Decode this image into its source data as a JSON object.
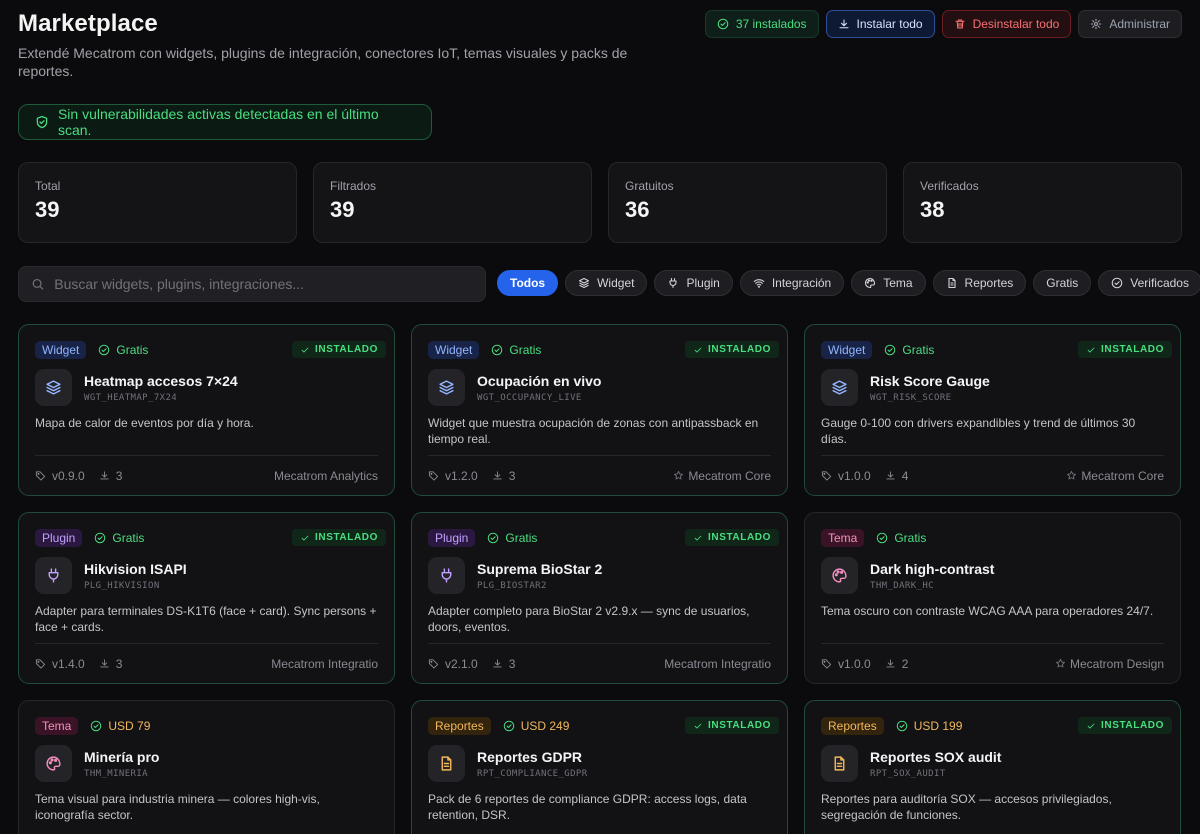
{
  "header": {
    "title": "Marketplace",
    "subtitle": "Extendé Mecatrom con widgets, plugins de integración, conectores IoT, temas visuales y packs de reportes.",
    "installed_label": "37 instalados",
    "install_all_label": "Instalar todo",
    "uninstall_all_label": "Desinstalar todo",
    "admin_label": "Administrar"
  },
  "alert": {
    "text": "Sin vulnerabilidades activas detectadas en el último scan."
  },
  "stats": [
    {
      "label": "Total",
      "value": "39"
    },
    {
      "label": "Filtrados",
      "value": "39"
    },
    {
      "label": "Gratuitos",
      "value": "36"
    },
    {
      "label": "Verificados",
      "value": "38"
    }
  ],
  "search": {
    "placeholder": "Buscar widgets, plugins, integraciones..."
  },
  "filters": [
    {
      "label": "Todos",
      "icon": "none",
      "active": true
    },
    {
      "label": "Widget",
      "icon": "layers-icon",
      "active": false
    },
    {
      "label": "Plugin",
      "icon": "plug-icon",
      "active": false
    },
    {
      "label": "Integración",
      "icon": "wifi-icon",
      "active": false
    },
    {
      "label": "Tema",
      "icon": "palette-icon",
      "active": false
    },
    {
      "label": "Reportes",
      "icon": "file-icon",
      "active": false
    },
    {
      "label": "Gratis",
      "icon": "none",
      "active": false
    },
    {
      "label": "Verificados",
      "icon": "check-circle-icon",
      "active": false
    }
  ],
  "installed_badge_label": "INSTALADO",
  "colors": {
    "accent": "#2563eb",
    "success": "#4ade80",
    "danger": "#f87171",
    "warning": "#f2b85a"
  },
  "cards": [
    {
      "category": "Widget",
      "cat_class": "widget",
      "price": "Gratis",
      "free": true,
      "installed": true,
      "icon": "layers-icon",
      "title": "Heatmap accesos 7×24",
      "code": "WGT_HEATMAP_7X24",
      "desc": "Mapa de calor de eventos por día y hora.",
      "version": "v0.9.0",
      "downloads": "3",
      "vendor": "Mecatrom Analytics",
      "vendor_icon": "none"
    },
    {
      "category": "Widget",
      "cat_class": "widget",
      "price": "Gratis",
      "free": true,
      "installed": true,
      "icon": "layers-icon",
      "title": "Ocupación en vivo",
      "code": "WGT_OCCUPANCY_LIVE",
      "desc": "Widget que muestra ocupación de zonas con antipassback en tiempo real.",
      "version": "v1.2.0",
      "downloads": "3",
      "vendor": "Mecatrom Core",
      "vendor_icon": "star-icon"
    },
    {
      "category": "Widget",
      "cat_class": "widget",
      "price": "Gratis",
      "free": true,
      "installed": true,
      "icon": "layers-icon",
      "title": "Risk Score Gauge",
      "code": "WGT_RISK_SCORE",
      "desc": "Gauge 0-100 con drivers expandibles y trend de últimos 30 días.",
      "version": "v1.0.0",
      "downloads": "4",
      "vendor": "Mecatrom Core",
      "vendor_icon": "star-icon"
    },
    {
      "category": "Plugin",
      "cat_class": "plugin",
      "price": "Gratis",
      "free": true,
      "installed": true,
      "icon": "plug-icon",
      "title": "Hikvision ISAPI",
      "code": "PLG_HIKVISION",
      "desc": "Adapter para terminales DS-K1T6 (face + card). Sync persons + face + cards.",
      "version": "v1.4.0",
      "downloads": "3",
      "vendor": "Mecatrom Integratio",
      "vendor_icon": "none"
    },
    {
      "category": "Plugin",
      "cat_class": "plugin",
      "price": "Gratis",
      "free": true,
      "installed": true,
      "icon": "plug-icon",
      "title": "Suprema BioStar 2",
      "code": "PLG_BIOSTAR2",
      "desc": "Adapter completo para BioStar 2 v2.9.x — sync de usuarios, doors, eventos.",
      "version": "v2.1.0",
      "downloads": "3",
      "vendor": "Mecatrom Integratio",
      "vendor_icon": "none"
    },
    {
      "category": "Tema",
      "cat_class": "tema",
      "price": "Gratis",
      "free": true,
      "installed": false,
      "icon": "palette-icon",
      "title": "Dark high-contrast",
      "code": "THM_DARK_HC",
      "desc": "Tema oscuro con contraste WCAG AAA para operadores 24/7.",
      "version": "v1.0.0",
      "downloads": "2",
      "vendor": "Mecatrom Design",
      "vendor_icon": "star-icon"
    },
    {
      "category": "Tema",
      "cat_class": "tema",
      "price": "USD 79",
      "free": false,
      "installed": false,
      "icon": "palette-icon",
      "title": "Minería pro",
      "code": "THM_MINERIA",
      "desc": "Tema visual para industria minera — colores high-vis, iconografía sector.",
      "version": "",
      "downloads": "",
      "vendor": "",
      "vendor_icon": "none"
    },
    {
      "category": "Reportes",
      "cat_class": "reportes",
      "price": "USD 249",
      "free": false,
      "installed": true,
      "icon": "file-icon",
      "title": "Reportes GDPR",
      "code": "RPT_COMPLIANCE_GDPR",
      "desc": "Pack de 6 reportes de compliance GDPR: access logs, data retention, DSR.",
      "version": "",
      "downloads": "",
      "vendor": "",
      "vendor_icon": "none"
    },
    {
      "category": "Reportes",
      "cat_class": "reportes",
      "price": "USD 199",
      "free": false,
      "installed": true,
      "icon": "file-icon",
      "title": "Reportes SOX audit",
      "code": "RPT_SOX_AUDIT",
      "desc": "Reportes para auditoría SOX — accesos privilegiados, segregación de funciones.",
      "version": "",
      "downloads": "",
      "vendor": "",
      "vendor_icon": "none"
    }
  ]
}
